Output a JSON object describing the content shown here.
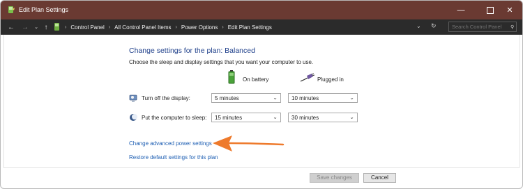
{
  "window": {
    "title": "Edit Plan Settings",
    "titlebar_color": "#6a3a32",
    "minimize_icon": "minimize-icon",
    "maximize_icon": "maximize-icon",
    "close_icon": "close-icon"
  },
  "address_bar": {
    "back_icon": "back-arrow-icon",
    "forward_icon": "forward-arrow-icon",
    "recent_icon": "chevron-down-icon",
    "up_icon": "up-arrow-icon",
    "breadcrumbs": [
      "Control Panel",
      "All Control Panel Items",
      "Power Options",
      "Edit Plan Settings"
    ],
    "search_placeholder": "Search Control Panel"
  },
  "main": {
    "heading": "Change settings for the plan: Balanced",
    "description": "Choose the sleep and display settings that you want your computer to use.",
    "columns": {
      "on_battery": "On battery",
      "plugged_in": "Plugged in"
    },
    "rows": [
      {
        "label": "Turn off the display:",
        "on_battery": "5 minutes",
        "plugged_in": "10 minutes",
        "icon": "display-icon"
      },
      {
        "label": "Put the computer to sleep:",
        "on_battery": "15 minutes",
        "plugged_in": "30 minutes",
        "icon": "sleep-moon-icon"
      }
    ],
    "links": {
      "advanced": "Change advanced power settings",
      "restore": "Restore default settings for this plan"
    },
    "annotation_arrow_color": "#ee7a2c"
  },
  "footer": {
    "save": "Save changes",
    "cancel": "Cancel"
  }
}
